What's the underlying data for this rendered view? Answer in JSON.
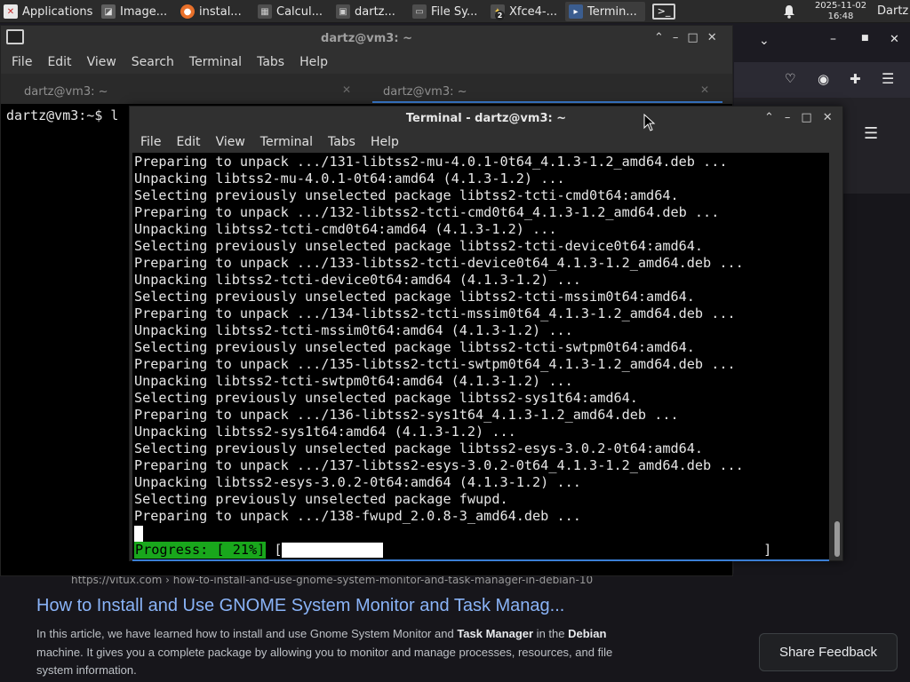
{
  "panel": {
    "applications": "Applications",
    "tasks": [
      {
        "label": "Image...",
        "icon": "image-viewer-icon",
        "color": "#6a6a6a"
      },
      {
        "label": "instal...",
        "icon": "firefox-icon",
        "color": "#e8702a"
      },
      {
        "label": "Calcul...",
        "icon": "calculator-icon",
        "color": "#5a5a5a"
      },
      {
        "label": "dartz...",
        "icon": "image-icon",
        "color": "#5a5a5a"
      },
      {
        "label": "File Sy...",
        "icon": "folder-icon",
        "color": "#5a5a5a"
      },
      {
        "label": "Xfce4-...",
        "icon": "xfce-icon",
        "color": "#5a5a5a",
        "badge": "2"
      },
      {
        "label": "Termin...",
        "icon": "terminal-icon",
        "color": "#4a6a9a"
      }
    ],
    "clock_date": "2025-11-02",
    "clock_time": "16:48",
    "user": "Dartz"
  },
  "back_terminal": {
    "title": "dartz@vm3: ~",
    "menu": [
      "File",
      "Edit",
      "View",
      "Search",
      "Terminal",
      "Tabs",
      "Help"
    ],
    "tabs": [
      "dartz@vm3: ~",
      "dartz@vm3: ~"
    ],
    "prompt_user": "dartz@vm3",
    "prompt_path": ":~$ l"
  },
  "front_terminal": {
    "title": "Terminal - dartz@vm3: ~",
    "menu": [
      "File",
      "Edit",
      "View",
      "Terminal",
      "Tabs",
      "Help"
    ],
    "lines": [
      "Preparing to unpack .../131-libtss2-mu-4.0.1-0t64_4.1.3-1.2_amd64.deb ...",
      "Unpacking libtss2-mu-4.0.1-0t64:amd64 (4.1.3-1.2) ...",
      "Selecting previously unselected package libtss2-tcti-cmd0t64:amd64.",
      "Preparing to unpack .../132-libtss2-tcti-cmd0t64_4.1.3-1.2_amd64.deb ...",
      "Unpacking libtss2-tcti-cmd0t64:amd64 (4.1.3-1.2) ...",
      "Selecting previously unselected package libtss2-tcti-device0t64:amd64.",
      "Preparing to unpack .../133-libtss2-tcti-device0t64_4.1.3-1.2_amd64.deb ...",
      "Unpacking libtss2-tcti-device0t64:amd64 (4.1.3-1.2) ...",
      "Selecting previously unselected package libtss2-tcti-mssim0t64:amd64.",
      "Preparing to unpack .../134-libtss2-tcti-mssim0t64_4.1.3-1.2_amd64.deb ...",
      "Unpacking libtss2-tcti-mssim0t64:amd64 (4.1.3-1.2) ...",
      "Selecting previously unselected package libtss2-tcti-swtpm0t64:amd64.",
      "Preparing to unpack .../135-libtss2-tcti-swtpm0t64_4.1.3-1.2_amd64.deb ...",
      "Unpacking libtss2-tcti-swtpm0t64:amd64 (4.1.3-1.2) ...",
      "Selecting previously unselected package libtss2-sys1t64:amd64.",
      "Preparing to unpack .../136-libtss2-sys1t64_4.1.3-1.2_amd64.deb ...",
      "Unpacking libtss2-sys1t64:amd64 (4.1.3-1.2) ...",
      "Selecting previously unselected package libtss2-esys-3.0.2-0t64:amd64.",
      "Preparing to unpack .../137-libtss2-esys-3.0.2-0t64_4.1.3-1.2_amd64.deb ...",
      "Unpacking libtss2-esys-3.0.2-0t64:amd64 (4.1.3-1.2) ...",
      "Selecting previously unselected package fwupd.",
      "Preparing to unpack .../138-fwupd_2.0.8-3_amd64.deb ..."
    ],
    "progress_label": "Progress: [ 21%]",
    "progress_fraction": 0.21
  },
  "article": {
    "url": "https://vitux.com › how-to-install-and-use-gnome-system-monitor-and-task-manager-in-debian-10",
    "title": "How to Install and Use GNOME System Monitor and Task Manag...",
    "text_a": "In this article, we have learned how to install and use Gnome System Monitor and ",
    "text_b": "Task Manager",
    "text_c": " in the ",
    "text_d": "Debian",
    "text_e": " machine. It gives you a complete package by allowing you to monitor and manage processes, resources, and file system information."
  },
  "share_feedback": "Share Feedback"
}
